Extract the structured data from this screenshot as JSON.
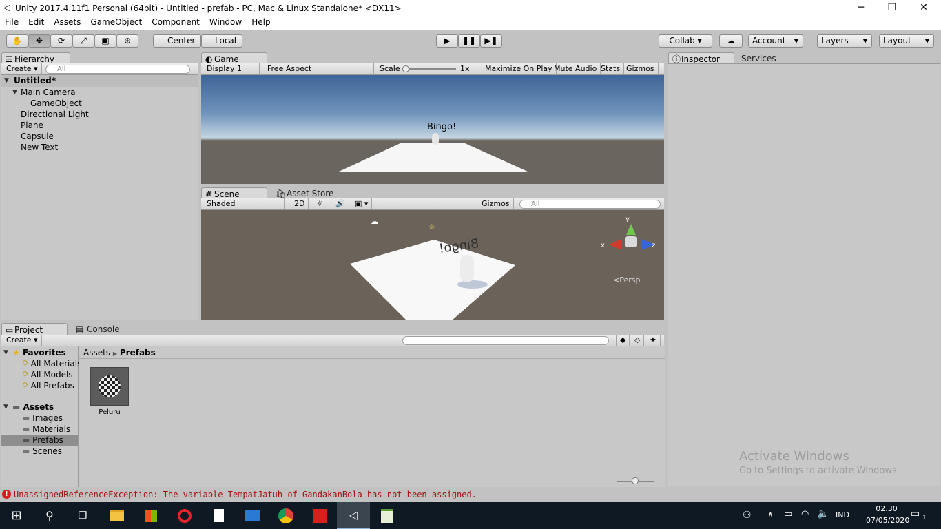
{
  "window": {
    "title": "Unity 2017.4.11f1 Personal (64bit) - Untitled - prefab - PC, Mac & Linux Standalone* <DX11>",
    "minimize": "─",
    "maximize": "❐",
    "close": "✕"
  },
  "menu": [
    "File",
    "Edit",
    "Assets",
    "GameObject",
    "Component",
    "Window",
    "Help"
  ],
  "toolbar": {
    "pivot": "Center",
    "space": "Local",
    "collab": "Collab ▾",
    "account": "Account",
    "layers": "Layers",
    "layout": "Layout"
  },
  "hierarchy": {
    "tab": "Hierarchy",
    "create": "Create",
    "search_placeholder": "All",
    "scene": "Untitled*",
    "items": [
      "Main Camera",
      "GameObject",
      "Directional Light",
      "Plane",
      "Capsule",
      "New Text"
    ]
  },
  "game": {
    "tab": "Game",
    "display": "Display 1",
    "aspect": "Free Aspect",
    "scale_label": "Scale",
    "scale_value": "1x",
    "maximize": "Maximize On Play",
    "mute": "Mute Audio",
    "stats": "Stats",
    "gizmos": "Gizmos",
    "world_text": "Bingo!"
  },
  "scene": {
    "tab": "Scene",
    "tab2": "Asset Store",
    "shading": "Shaded",
    "mode2d": "2D",
    "gizmos": "Gizmos",
    "search_placeholder": "All",
    "persp": "Persp",
    "axis_x": "x",
    "axis_y": "y",
    "axis_z": "z",
    "world_text": "Bingo!"
  },
  "inspector": {
    "tab": "Inspector",
    "tab2": "Services"
  },
  "project": {
    "tab": "Project",
    "tab2": "Console",
    "create": "Create",
    "favorites_label": "Favorites",
    "favorites": [
      "All Materials",
      "All Models",
      "All Prefabs"
    ],
    "assets_label": "Assets",
    "folders": [
      "Images",
      "Materials",
      "Prefabs",
      "Scenes"
    ],
    "breadcrumb": [
      "Assets",
      "Prefabs"
    ],
    "items": [
      {
        "name": "Peluru"
      }
    ]
  },
  "status": {
    "error": "UnassignedReferenceException: The variable TempatJatuh of GandakanBola has not been assigned."
  },
  "watermark": {
    "line1": "Activate Windows",
    "line2": "Go to Settings to activate Windows."
  },
  "taskbar": {
    "lang": "IND",
    "time": "02.30",
    "date": "07/05/2020",
    "notif": "1"
  }
}
